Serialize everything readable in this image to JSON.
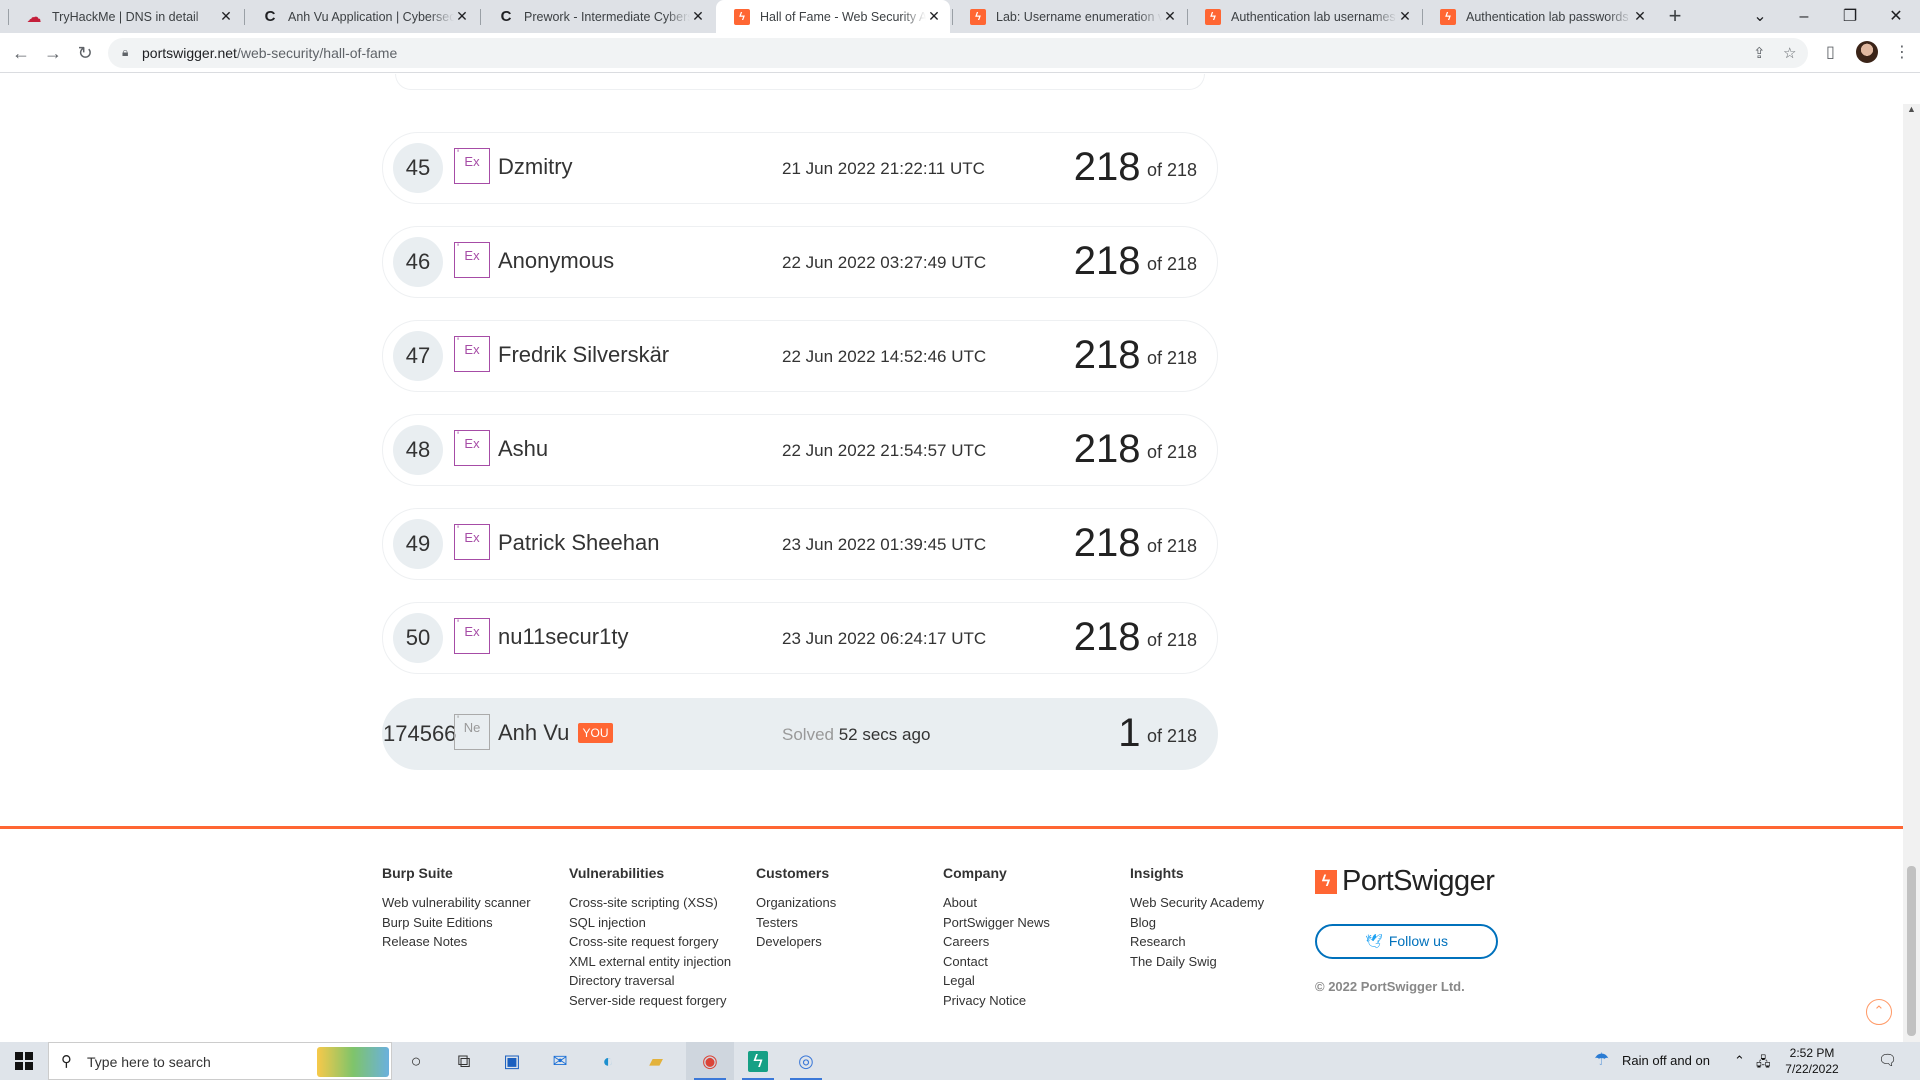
{
  "browser": {
    "tabs": [
      {
        "title": "TryHackMe | DNS in detail",
        "favicon": "tryhackme-icon",
        "active": false
      },
      {
        "title": "Anh Vu Application | Cybersecurity",
        "favicon": "codepath-icon",
        "active": false
      },
      {
        "title": "Prework - Intermediate Cybersecurity",
        "favicon": "codepath-icon",
        "active": false
      },
      {
        "title": "Hall of Fame - Web Security Academy",
        "favicon": "portswigger-icon",
        "active": true
      },
      {
        "title": "Lab: Username enumeration via different responses",
        "favicon": "portswigger-icon",
        "active": false
      },
      {
        "title": "Authentication lab usernames | Web Security Academy",
        "favicon": "portswigger-icon",
        "active": false
      },
      {
        "title": "Authentication lab passwords | Web Security Academy",
        "favicon": "portswigger-icon",
        "active": false
      }
    ],
    "url_host": "portswigger.net",
    "url_path": "/web-security/hall-of-fame"
  },
  "leaderboard": [
    {
      "rank": "45",
      "badge": "Ex",
      "name": "Dzmitry",
      "time": "21 Jun 2022 21:22:11 UTC",
      "score": "218",
      "of": "of 218"
    },
    {
      "rank": "46",
      "badge": "Ex",
      "name": "Anonymous",
      "time": "22 Jun 2022 03:27:49 UTC",
      "score": "218",
      "of": "of 218"
    },
    {
      "rank": "47",
      "badge": "Ex",
      "name": "Fredrik Silverskär",
      "time": "22 Jun 2022 14:52:46 UTC",
      "score": "218",
      "of": "of 218"
    },
    {
      "rank": "48",
      "badge": "Ex",
      "name": "Ashu",
      "time": "22 Jun 2022 21:54:57 UTC",
      "score": "218",
      "of": "of 218"
    },
    {
      "rank": "49",
      "badge": "Ex",
      "name": "Patrick Sheehan",
      "time": "23 Jun 2022 01:39:45 UTC",
      "score": "218",
      "of": "of 218"
    },
    {
      "rank": "50",
      "badge": "Ex",
      "name": "nu11secur1ty",
      "time": "23 Jun 2022 06:24:17 UTC",
      "score": "218",
      "of": "of 218"
    }
  ],
  "current_user": {
    "rank": "174566",
    "badge": "Ne",
    "name": "Anh Vu",
    "you_tag": "YOU",
    "solved_label": "Solved",
    "solved_time": "52 secs ago",
    "score": "1",
    "of": "of 218"
  },
  "footer": {
    "columns": [
      {
        "heading": "Burp Suite",
        "links": [
          "Web vulnerability scanner",
          "Burp Suite Editions",
          "Release Notes"
        ]
      },
      {
        "heading": "Vulnerabilities",
        "links": [
          "Cross-site scripting (XSS)",
          "SQL injection",
          "Cross-site request forgery",
          "XML external entity injection",
          "Directory traversal",
          "Server-side request forgery"
        ]
      },
      {
        "heading": "Customers",
        "links": [
          "Organizations",
          "Testers",
          "Developers"
        ]
      },
      {
        "heading": "Company",
        "links": [
          "About",
          "PortSwigger News",
          "Careers",
          "Contact",
          "Legal",
          "Privacy Notice"
        ]
      },
      {
        "heading": "Insights",
        "links": [
          "Web Security Academy",
          "Blog",
          "Research",
          "The Daily Swig"
        ]
      }
    ],
    "brand": "PortSwigger",
    "follow_label": "Follow us",
    "copyright": "© 2022 PortSwigger Ltd."
  },
  "taskbar": {
    "search_placeholder": "Type here to search",
    "weather": "Rain off and on",
    "time": "2:52 PM",
    "date": "7/22/2022"
  },
  "colors": {
    "accent": "#ff6633",
    "badge_expert": "#a64ca6",
    "twitter_blue": "#0071bc",
    "row_highlight": "#e9eef1"
  }
}
